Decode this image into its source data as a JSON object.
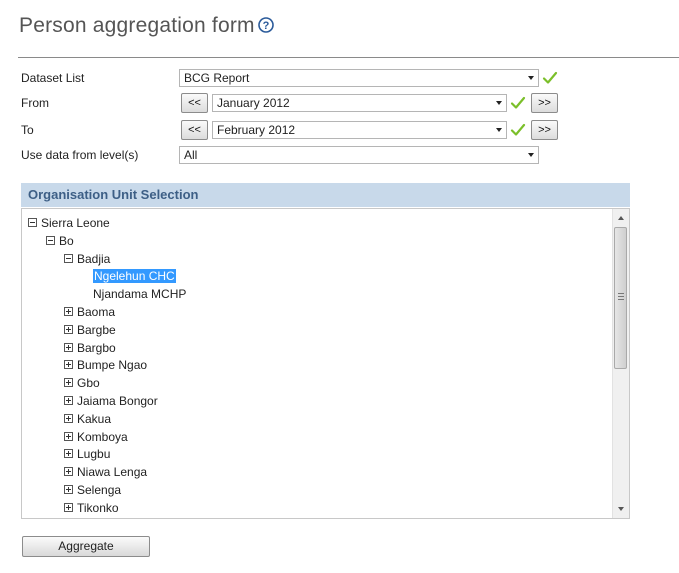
{
  "page": {
    "title": "Person aggregation form",
    "help_icon": "help-circle-icon"
  },
  "form": {
    "dataset": {
      "label": "Dataset List",
      "value": "BCG Report"
    },
    "from": {
      "label": "From",
      "value": "January 2012",
      "prev": "<<",
      "next": ">>"
    },
    "to": {
      "label": "To",
      "value": "February 2012",
      "prev": "<<",
      "next": ">>"
    },
    "level": {
      "label": "Use data from level(s)",
      "value": "All"
    },
    "valid_icon": "checkmark-icon"
  },
  "org_unit": {
    "header": "Organisation Unit Selection",
    "tree": [
      {
        "label": "Sierra Leone",
        "depth": 0,
        "toggle": "minus"
      },
      {
        "label": "Bo",
        "depth": 1,
        "toggle": "minus"
      },
      {
        "label": "Badjia",
        "depth": 2,
        "toggle": "minus"
      },
      {
        "label": "Ngelehun CHC",
        "depth": 3,
        "toggle": "none",
        "selected": true
      },
      {
        "label": "Njandama MCHP",
        "depth": 3,
        "toggle": "none"
      },
      {
        "label": "Baoma",
        "depth": 2,
        "toggle": "plus"
      },
      {
        "label": "Bargbe",
        "depth": 2,
        "toggle": "plus"
      },
      {
        "label": "Bargbo",
        "depth": 2,
        "toggle": "plus"
      },
      {
        "label": "Bumpe Ngao",
        "depth": 2,
        "toggle": "plus"
      },
      {
        "label": "Gbo",
        "depth": 2,
        "toggle": "plus"
      },
      {
        "label": "Jaiama Bongor",
        "depth": 2,
        "toggle": "plus"
      },
      {
        "label": "Kakua",
        "depth": 2,
        "toggle": "plus"
      },
      {
        "label": "Komboya",
        "depth": 2,
        "toggle": "plus"
      },
      {
        "label": "Lugbu",
        "depth": 2,
        "toggle": "plus"
      },
      {
        "label": "Niawa Lenga",
        "depth": 2,
        "toggle": "plus"
      },
      {
        "label": "Selenga",
        "depth": 2,
        "toggle": "plus"
      },
      {
        "label": "Tikonko",
        "depth": 2,
        "toggle": "plus"
      }
    ]
  },
  "actions": {
    "aggregate": "Aggregate"
  },
  "colors": {
    "accent": "#3d5f86",
    "header_bg": "#c8d9ea",
    "selection": "#3399ff",
    "check": "#7bbf2a"
  }
}
